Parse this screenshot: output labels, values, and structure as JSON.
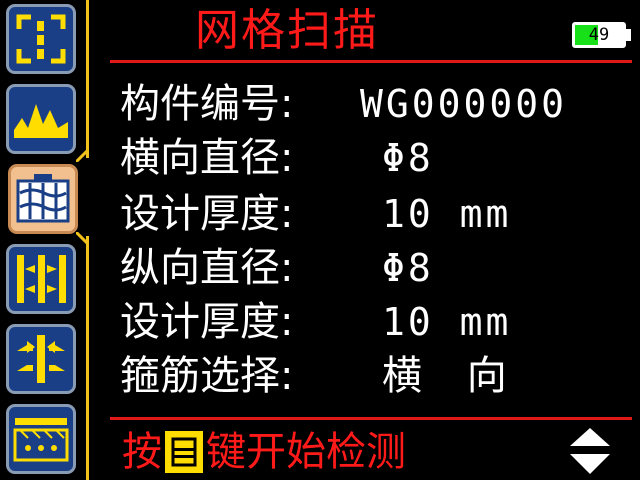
{
  "header": {
    "title": "网格扫描"
  },
  "battery": {
    "level_text": "49",
    "level_percent": 49,
    "fill_color": "#18e018"
  },
  "sidebar": {
    "items": [
      {
        "name": "scan-frame-icon",
        "active": false
      },
      {
        "name": "mountain-wave-icon",
        "active": false
      },
      {
        "name": "grid-scan-icon",
        "active": true
      },
      {
        "name": "horizontal-rebar-icon",
        "active": false
      },
      {
        "name": "vertical-rebar-icon",
        "active": false
      },
      {
        "name": "slab-section-icon",
        "active": false
      }
    ]
  },
  "params": [
    {
      "label": "构件编号:",
      "value": "WG000000"
    },
    {
      "label": "横向直径:",
      "value": "Φ8"
    },
    {
      "label": "设计厚度:",
      "value": "10 mm"
    },
    {
      "label": "纵向直径:",
      "value": "Φ8"
    },
    {
      "label": "设计厚度:",
      "value": "10 mm"
    },
    {
      "label": "箍筋选择:",
      "value": "横 向"
    }
  ],
  "footer": {
    "prefix": "按",
    "suffix": "键开始检测"
  },
  "colors": {
    "accent": "#e01818",
    "sidebar_line": "#f3c21a",
    "button_bg": "#1a3f86",
    "active_bg": "#f2c08e",
    "icon": "#ffdd00"
  }
}
